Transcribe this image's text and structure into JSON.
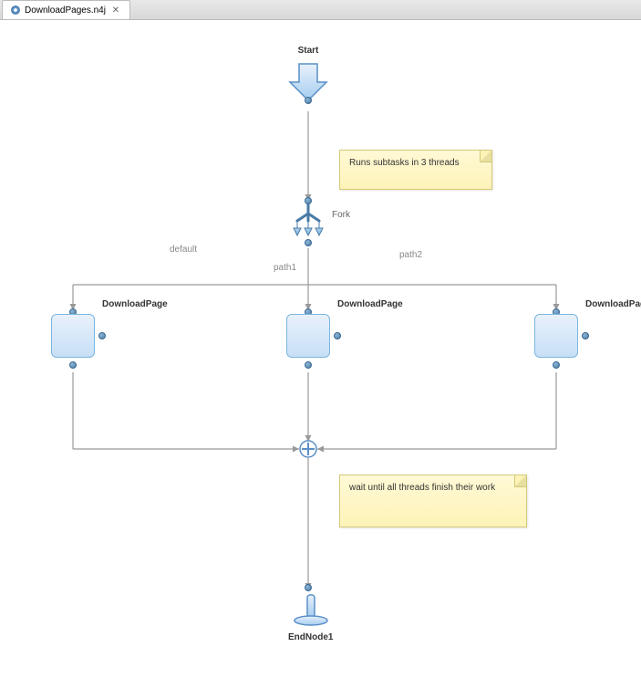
{
  "tab": {
    "title": "DownloadPages.n4j"
  },
  "nodes": {
    "start": {
      "label": "Start"
    },
    "fork": {
      "label": "Fork"
    },
    "dl1": {
      "label": "DownloadPage"
    },
    "dl2": {
      "label": "DownloadPage"
    },
    "dl3": {
      "label": "DownloadPage"
    },
    "end": {
      "label": "EndNode1"
    }
  },
  "edges": {
    "default": "default",
    "path1": "path1",
    "path2": "path2"
  },
  "notes": {
    "n1": "Runs subtasks in 3 threads",
    "n2": "wait until all threads finish their work"
  }
}
